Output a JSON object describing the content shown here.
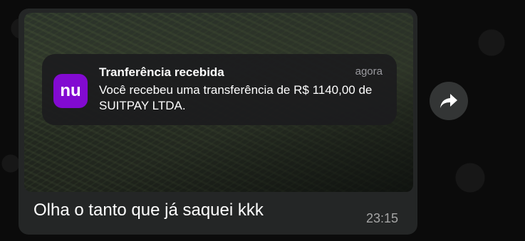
{
  "notification": {
    "app_icon_text": "nu",
    "app_color": "#820ad1",
    "title": "Tranferência recebida",
    "time": "agora",
    "body": "Você recebeu uma transferência de R$ 1140,00 de SUITPAY LTDA."
  },
  "message": {
    "caption": "Olha o tanto que já saquei kkk",
    "time": "23:15"
  },
  "icons": {
    "forward": "forward-share-icon"
  }
}
